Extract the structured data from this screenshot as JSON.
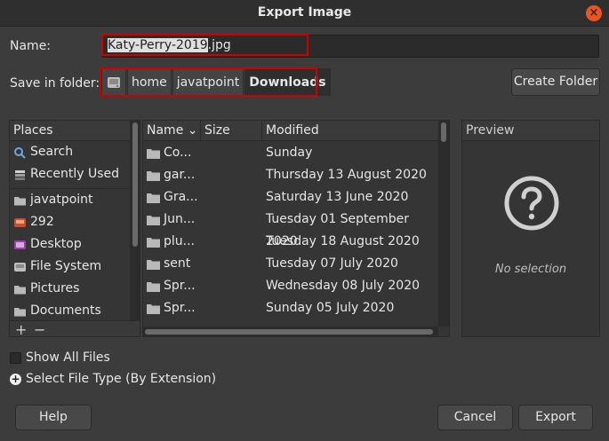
{
  "window": {
    "title": "Export Image"
  },
  "name_field": {
    "label": "Name:",
    "selected_part": "Katy-Perry-2019",
    "extension_part": ".jpg"
  },
  "folder": {
    "label": "Save in folder:",
    "crumbs": [
      "home",
      "javatpoint",
      "Downloads"
    ],
    "create_folder_label": "Create Folder"
  },
  "places": {
    "header": "Places",
    "items": [
      {
        "label": "Search",
        "icon": "search-icon"
      },
      {
        "label": "Recently Used",
        "icon": "recent-icon"
      },
      {
        "label": "javatpoint",
        "icon": "folder-icon"
      },
      {
        "label": "292",
        "icon": "drive-icon"
      },
      {
        "label": "Desktop",
        "icon": "desktop-icon"
      },
      {
        "label": "File System",
        "icon": "filesystem-icon"
      },
      {
        "label": "Pictures",
        "icon": "folder-icon"
      },
      {
        "label": "Documents",
        "icon": "folder-icon"
      }
    ],
    "add_symbol": "+",
    "remove_symbol": "−"
  },
  "files": {
    "columns": {
      "name": "Name",
      "size": "Size",
      "modified": "Modified"
    },
    "rows": [
      {
        "name": "Co...",
        "modified": "Sunday"
      },
      {
        "name": "gar...",
        "modified": "Thursday 13 August 2020"
      },
      {
        "name": "Gra...",
        "modified": "Saturday 13 June 2020"
      },
      {
        "name": "Jun...",
        "modified": "Tuesday 01 September 2020"
      },
      {
        "name": "plu...",
        "modified": "Tuesday 18 August 2020"
      },
      {
        "name": "sent",
        "modified": "Tuesday 07 July 2020"
      },
      {
        "name": "Spr...",
        "modified": "Wednesday 08 July 2020"
      },
      {
        "name": "Spr...",
        "modified": "Sunday 05 July 2020"
      }
    ]
  },
  "preview": {
    "header": "Preview",
    "empty_text": "No selection"
  },
  "options": {
    "show_all_files": "Show All Files",
    "select_file_type": "Select File Type (By Extension)"
  },
  "buttons": {
    "help": "Help",
    "cancel": "Cancel",
    "export": "Export"
  },
  "colors": {
    "highlight": "#d00000",
    "close_button": "#e95420"
  }
}
